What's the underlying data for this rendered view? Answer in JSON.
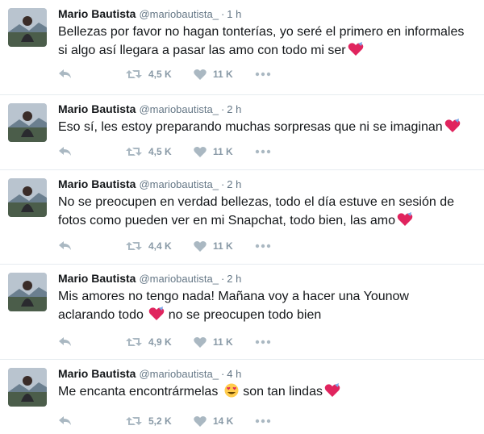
{
  "author": {
    "name": "Mario Bautista",
    "handle": "@mariobautista_"
  },
  "colors": {
    "text": "#14171a",
    "secondary": "#657786",
    "action_icon": "#aab8c2",
    "divider": "#e6ecf0",
    "heart_emoji": "#e0245e"
  },
  "tweets": [
    {
      "time": "1 h",
      "lines": [
        "Bellezas por favor no hagan tonterías, yo seré el primero en informales",
        "si algo así llegara a pasar las amo con todo mi ser"
      ],
      "retweets": "4,5 K",
      "likes": "11 K"
    },
    {
      "time": "2 h",
      "lines": [
        "Eso sí, les estoy preparando muchas sorpresas que ni se imaginan"
      ],
      "retweets": "4,5 K",
      "likes": "11 K"
    },
    {
      "time": "2 h",
      "lines": [
        "No se preocupen en verdad bellezas, todo el día estuve en sesión de",
        "fotos como pueden ver en mi Snapchat, todo bien, las amo"
      ],
      "retweets": "4,4 K",
      "likes": "11 K"
    },
    {
      "time": "2 h",
      "lines": [
        "Mis amores no tengo nada! Mañana voy a hacer una Younow",
        "aclarando todo",
        "no se preocupen todo bien"
      ],
      "retweets": "4,9 K",
      "likes": "11 K"
    },
    {
      "time": "4 h",
      "lines": [
        "Me encanta encontrármelas",
        "son tan lindas"
      ],
      "retweets": "5,2 K",
      "likes": "14 K"
    }
  ],
  "icons": {
    "reply": "reply-icon",
    "retweet": "retweet-icon",
    "like": "heart-icon",
    "more": "more-dots-icon",
    "emoji_heart": "sparkling-heart-emoji-icon",
    "emoji_smile": "heart-eyes-emoji-icon"
  }
}
